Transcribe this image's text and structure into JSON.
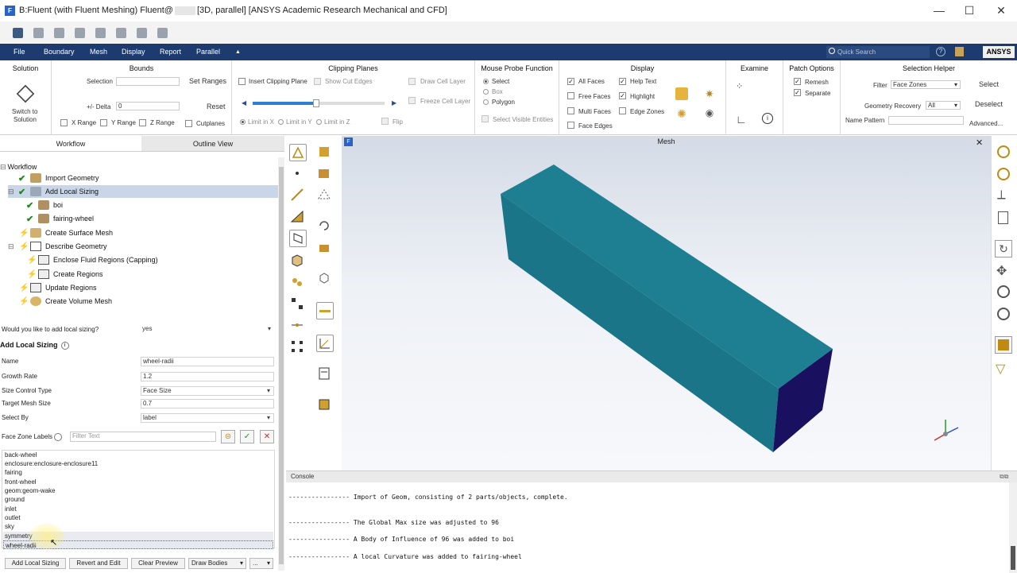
{
  "window": {
    "title_prefix": "B:Fluent (with Fluent Meshing) Fluent@",
    "title_suffix": "[3D, parallel] [ANSYS Academic Research Mechanical and CFD]",
    "app_icon": "F",
    "min_glyph": "—",
    "max_glyph": "☐",
    "close_glyph": "✕"
  },
  "menu": {
    "items": [
      "File",
      "Boundary",
      "Mesh",
      "Display",
      "Report",
      "Parallel",
      "▲"
    ],
    "quick_search_placeholder": "Quick Search",
    "logo": "ANSYS"
  },
  "ribbon": {
    "solution": {
      "title": "Solution",
      "switch_label_1": "Switch to",
      "switch_label_2": "Solution"
    },
    "bounds": {
      "title": "Bounds",
      "selection_label": "Selection",
      "delta_label": "+/- Delta",
      "delta_value": "0",
      "set_ranges": "Set Ranges",
      "reset": "Reset",
      "x_range": "X Range",
      "y_range": "Y Range",
      "z_range": "Z Range",
      "cutplanes": "Cutplanes"
    },
    "clipping": {
      "title": "Clipping Planes",
      "insert": "Insert Clipping Plane",
      "show_cut_edges": "Show Cut Edges",
      "draw_cell_layer": "Draw Cell Layer",
      "freeze_cell_layer": "Freeze Cell Layer",
      "limit_x": "Limit in X",
      "limit_y": "Limit in Y",
      "limit_z": "Limit in Z",
      "flip": "Flip",
      "slider_value": 0.48
    },
    "probe": {
      "title": "Mouse Probe Function",
      "select": "Select",
      "box": "Box",
      "polygon": "Polygon",
      "select_visible": "Select Visible Entities"
    },
    "display": {
      "title": "Display",
      "all_faces": "All Faces",
      "free_faces": "Free Faces",
      "multi_faces": "Multi Faces",
      "face_edges": "Face Edges",
      "help_text": "Help Text",
      "highlight": "Highlight",
      "edge_zones": "Edge Zones"
    },
    "examine": {
      "title": "Examine"
    },
    "patch": {
      "title": "Patch Options",
      "remesh": "Remesh",
      "separate": "Separate"
    },
    "selection_helper": {
      "title": "Selection Helper",
      "filter_label": "Filter",
      "filter_value": "Face Zones",
      "select": "Select",
      "geom_recovery_label": "Geometry Recovery",
      "geom_recovery_value": "All",
      "deselect": "Deselect",
      "name_pattern_label": "Name Pattern",
      "advanced": "Advanced..."
    }
  },
  "left_panel": {
    "tabs": [
      "Workflow",
      "Outline View"
    ],
    "tree": [
      {
        "label": "Workflow",
        "indent": 0
      },
      {
        "label": "Import Geometry",
        "indent": 1
      },
      {
        "label": "Add Local Sizing",
        "indent": 1
      },
      {
        "label": "boi",
        "indent": 2
      },
      {
        "label": "fairing-wheel",
        "indent": 2
      },
      {
        "label": "Create Surface Mesh",
        "indent": 1
      },
      {
        "label": "Describe Geometry",
        "indent": 1
      },
      {
        "label": "Enclose Fluid Regions (Capping)",
        "indent": 2
      },
      {
        "label": "Create Regions",
        "indent": 2
      },
      {
        "label": "Update Regions",
        "indent": 1
      },
      {
        "label": "Create Volume Mesh",
        "indent": 1
      }
    ],
    "question": {
      "label": "Would you like to add local sizing?",
      "value": "yes"
    },
    "section_title": "Add Local Sizing",
    "fields": {
      "name": {
        "label": "Name",
        "value": "wheel-radii"
      },
      "growth_rate": {
        "label": "Growth Rate",
        "value": "1.2"
      },
      "size_control": {
        "label": "Size Control Type",
        "value": "Face Size"
      },
      "target_mesh": {
        "label": "Target Mesh Size",
        "value": "0.7"
      },
      "select_by": {
        "label": "Select By",
        "value": "label"
      }
    },
    "face_zone_labels": "Face Zone Labels",
    "filter_placeholder": "Filter Text",
    "face_list": [
      "back-wheel",
      "enclosure:enclosure-enclosure11",
      "fairing",
      "front-wheel",
      "geom:geom-wake",
      "ground",
      "inlet",
      "outlet",
      "sky",
      "symmetry",
      "wheel-radii"
    ],
    "buttons": {
      "add": "Add Local Sizing",
      "revert": "Revert and Edit",
      "clear": "Clear Preview",
      "draw": "Draw Bodies",
      "more": "..."
    }
  },
  "viewport": {
    "title": "Mesh",
    "close": "✕",
    "icon": "F"
  },
  "console": {
    "title": "Console",
    "lines": [
      "---------------- Import of Geom, consisting of 2 parts/objects, complete.",
      "",
      "",
      "---------------- The Global Max size was adjusted to 96",
      "",
      "---------------- A Body of Influence of 96 was added to boi",
      "",
      "---------------- A local Curvature was added to fairing-wheel"
    ]
  },
  "colors": {
    "menu_bg": "#1d3b6e",
    "box_top": "#1e7f92",
    "box_side": "#166b7e",
    "box_end": "#1a1060"
  }
}
